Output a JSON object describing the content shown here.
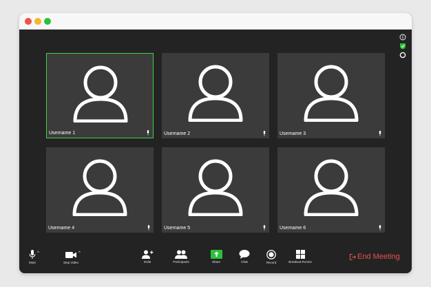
{
  "participants": [
    {
      "username": "Username 1",
      "active": true
    },
    {
      "username": "Username 2",
      "active": false
    },
    {
      "username": "Username 3",
      "active": false
    },
    {
      "username": "Username 4",
      "active": false
    },
    {
      "username": "Username 5",
      "active": false
    },
    {
      "username": "Username 6",
      "active": false
    }
  ],
  "toolbar": {
    "mute": "Mute",
    "stop_video": "Stop Video",
    "invite": "Invite",
    "participants": "Participants",
    "share": "Share",
    "chat": "Chat",
    "record": "Record",
    "breakout_rooms": "Breakout Rooms",
    "end_meeting": "End Meeting"
  },
  "status_icons": [
    "info-icon",
    "shield-check-icon",
    "record-indicator-icon"
  ],
  "colors": {
    "active_border": "#3fd04a",
    "share_green": "#2cc13c",
    "end_meeting_red": "#e8524c",
    "tile_bg": "#3b3b3b",
    "window_bg": "#232323"
  }
}
